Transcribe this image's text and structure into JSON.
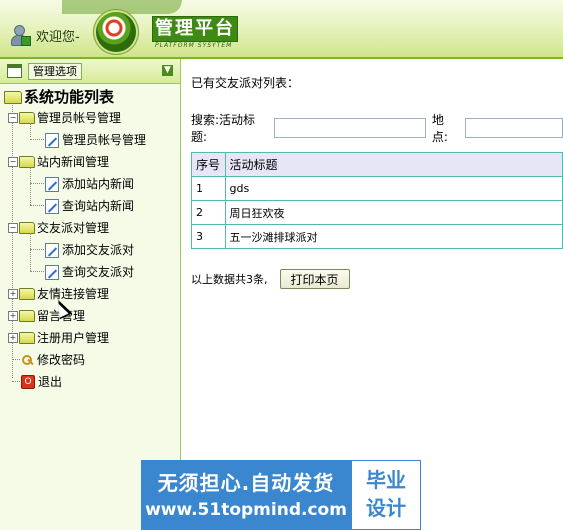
{
  "header": {
    "welcome": "欢迎您-",
    "platform_title": "管理平台",
    "platform_subtitle": "PLATFORM SYSYTEM"
  },
  "sidebar": {
    "menu_label": "管理选项",
    "tree_title": "系统功能列表",
    "groups": [
      {
        "label": "管理员帐号管理",
        "items": [
          {
            "label": "管理员帐号管理"
          }
        ],
        "expanded": true
      },
      {
        "label": "站内新闻管理",
        "items": [
          {
            "label": "添加站内新闻"
          },
          {
            "label": "查询站内新闻"
          }
        ],
        "expanded": true
      },
      {
        "label": "交友派对管理",
        "items": [
          {
            "label": "添加交友派对"
          },
          {
            "label": "查询交友派对"
          }
        ],
        "expanded": true
      },
      {
        "label": "友情连接管理",
        "items": [],
        "expanded": false
      },
      {
        "label": "留言管理",
        "items": [],
        "expanded": false
      },
      {
        "label": "注册用户管理",
        "items": [],
        "expanded": false
      }
    ],
    "change_password": "修改密码",
    "logout": "退出"
  },
  "main": {
    "list_heading": "已有交友派对列表：",
    "search": {
      "label": "搜索:活动标题:",
      "title_value": "",
      "location_label": "地点:",
      "location_value": ""
    },
    "table": {
      "headers": [
        "序号",
        "活动标题"
      ],
      "rows": [
        {
          "id": "1",
          "title": "gds"
        },
        {
          "id": "2",
          "title": "周日狂欢夜"
        },
        {
          "id": "3",
          "title": "五一沙滩排球派对"
        }
      ]
    },
    "summary": "以上数据共3条,",
    "print_button": "打印本页"
  },
  "watermark": {
    "line1": "无须担心.自动发货",
    "line2": "www.51topmind.com",
    "right1": "毕业",
    "right2": "设计"
  }
}
